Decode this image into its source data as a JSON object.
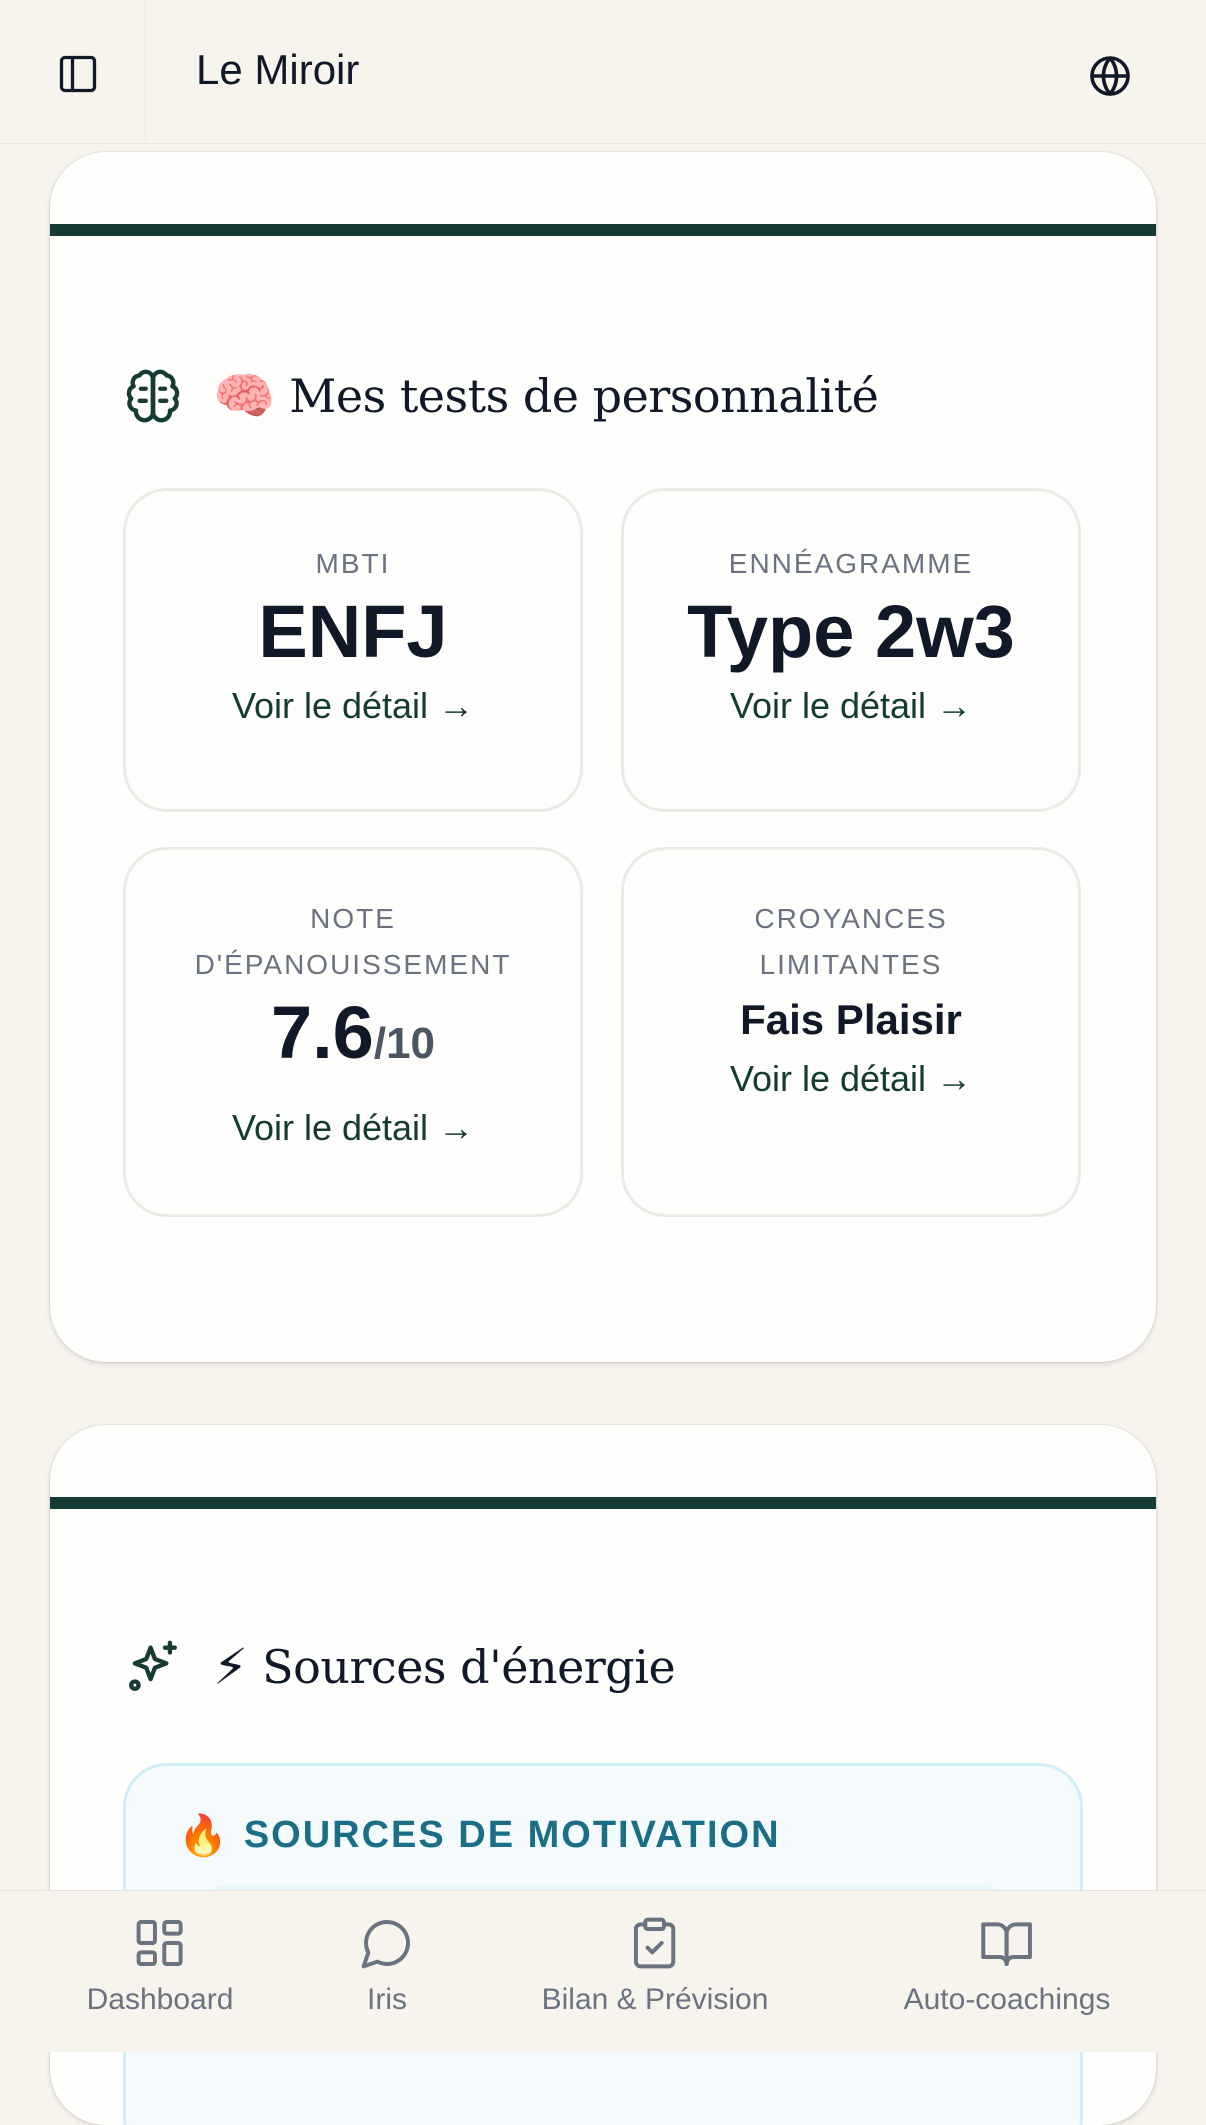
{
  "header": {
    "title": "Le Miroir",
    "left_icon": "sidebar-toggle-icon",
    "right_icon": "globe-icon"
  },
  "personality": {
    "emoji": "🧠",
    "title": "Mes tests de personnalité",
    "tiles": [
      {
        "label": "MBTI",
        "value": "ENFJ",
        "link": "Voir le détail →"
      },
      {
        "label": "ENNÉAGRAMME",
        "value": "Type 2w3",
        "link": "Voir le détail →"
      },
      {
        "label_line1": "NOTE",
        "label_line2": "D'ÉPANOUISSEMENT",
        "score": "7.6",
        "score_max": "/10",
        "link": "Voir le détail →"
      },
      {
        "label_line1": "CROYANCES",
        "label_line2": "LIMITANTES",
        "value": "Fais Plaisir",
        "link": "Voir le détail →"
      }
    ]
  },
  "energy": {
    "emoji": "⚡",
    "title": "Sources d'énergie",
    "motivation": {
      "emoji": "🔥",
      "label": "SOURCES DE MOTIVATION"
    }
  },
  "nav": [
    {
      "label": "Dashboard",
      "icon": "dashboard-icon"
    },
    {
      "label": "Iris",
      "icon": "chat-bubble-icon"
    },
    {
      "label": "Bilan & Prévision",
      "icon": "clipboard-check-icon"
    },
    {
      "label": "Auto-coachings",
      "icon": "book-icon"
    }
  ],
  "colors": {
    "accent": "#153b34",
    "background": "#f7f4ee",
    "motivation": "#1a6f86"
  }
}
